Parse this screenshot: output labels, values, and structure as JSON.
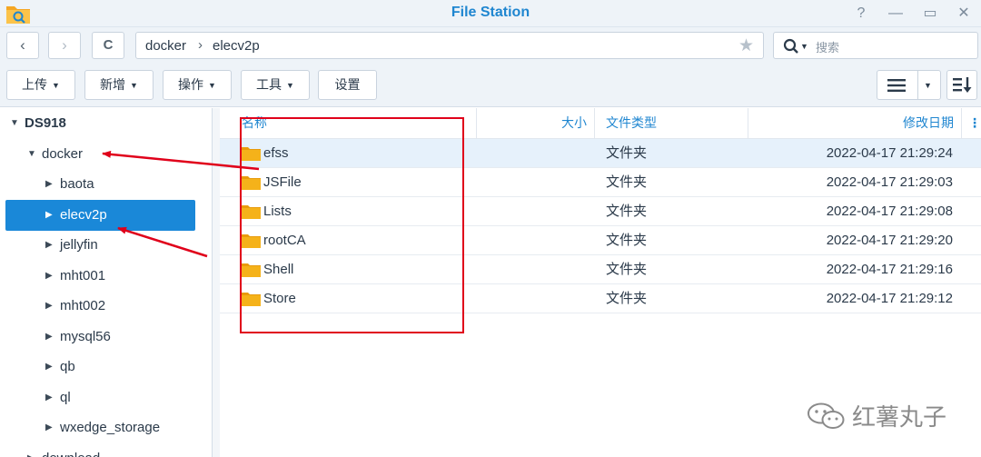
{
  "window": {
    "title": "File Station",
    "help_glyph": "?",
    "minimize_glyph": "—",
    "maximize_glyph": "▭",
    "close_glyph": "✕"
  },
  "nav": {
    "back_glyph": "‹",
    "forward_glyph": "›",
    "refresh_glyph": "C",
    "breadcrumb": [
      "docker",
      "elecv2p"
    ],
    "crumb_separator": "›",
    "favorite_glyph": "★",
    "search_placeholder": "搜索"
  },
  "toolbar": {
    "upload": "上传",
    "create": "新增",
    "action": "操作",
    "tools": "工具",
    "settings": "设置"
  },
  "tree": {
    "root": "DS918",
    "parent": "docker",
    "children": [
      "baota",
      "elecv2p",
      "jellyfin",
      "mht001",
      "mht002",
      "mysql56",
      "qb",
      "ql",
      "wxedge_storage"
    ],
    "selected": "elecv2p",
    "next_root_item": "download"
  },
  "columns": {
    "name": "名称",
    "size": "大小",
    "type": "文件类型",
    "modified": "修改日期"
  },
  "files": [
    {
      "name": "efss",
      "type": "文件夹",
      "modified": "2022-04-17 21:29:24"
    },
    {
      "name": "JSFile",
      "type": "文件夹",
      "modified": "2022-04-17 21:29:03"
    },
    {
      "name": "Lists",
      "type": "文件夹",
      "modified": "2022-04-17 21:29:08"
    },
    {
      "name": "rootCA",
      "type": "文件夹",
      "modified": "2022-04-17 21:29:20"
    },
    {
      "name": "Shell",
      "type": "文件夹",
      "modified": "2022-04-17 21:29:16"
    },
    {
      "name": "Store",
      "type": "文件夹",
      "modified": "2022-04-17 21:29:12"
    }
  ],
  "watermark": {
    "text": "红薯丸子"
  },
  "colors": {
    "accent": "#1f86d0",
    "selection": "#1a88d8",
    "folder": "#f5b21a",
    "annotation": "#e0001a"
  }
}
